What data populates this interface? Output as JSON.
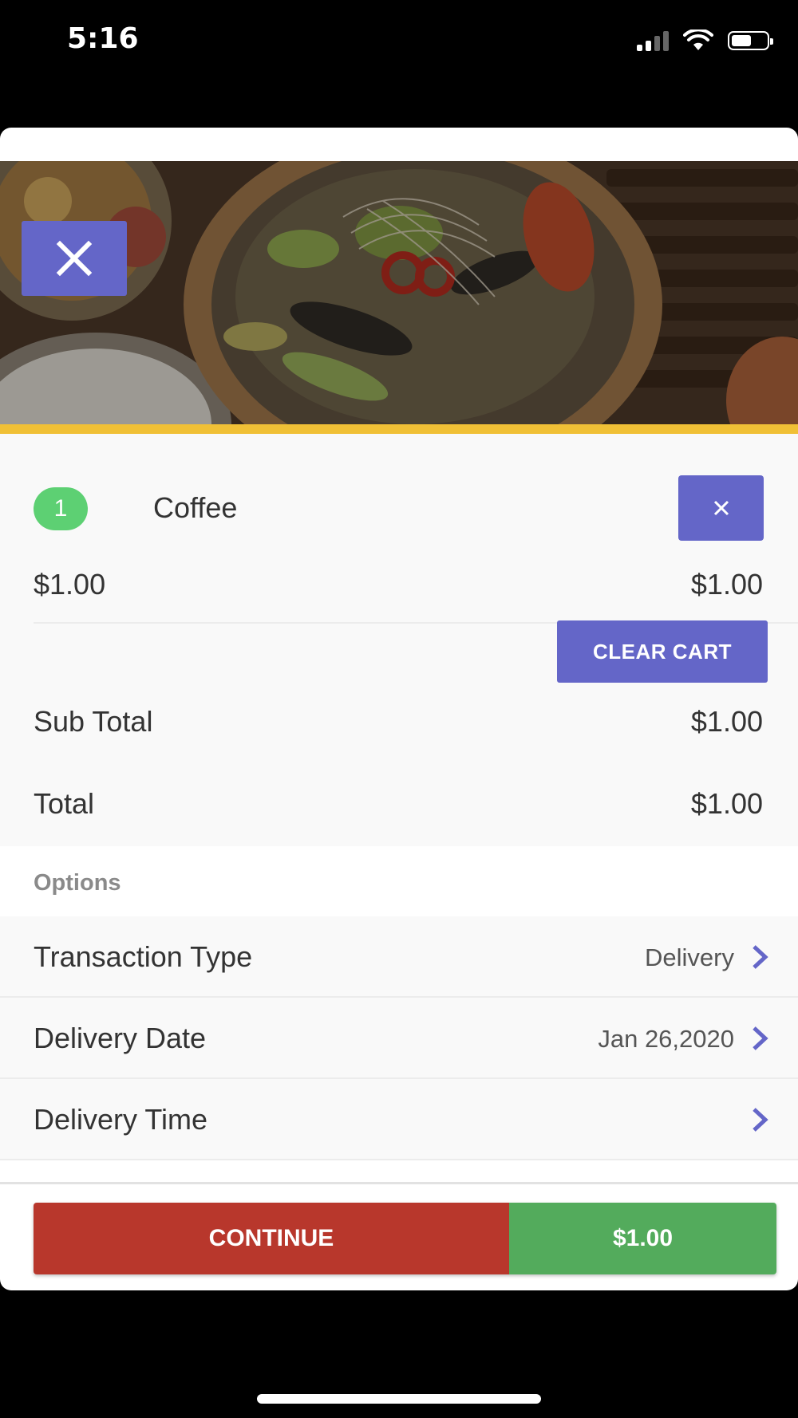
{
  "status_bar": {
    "time": "5:16"
  },
  "hero": {
    "close_icon": "close-icon"
  },
  "cart": {
    "items": [
      {
        "quantity": "1",
        "name": "Coffee",
        "unit_price": "$1.00",
        "line_total": "$1.00",
        "remove_icon": "close-icon"
      }
    ],
    "clear_cart_label": "CLEAR CART",
    "subtotal_label": "Sub Total",
    "subtotal_value": "$1.00",
    "total_label": "Total",
    "total_value": "$1.00"
  },
  "options": {
    "header": "Options",
    "rows": [
      {
        "label": "Transaction Type",
        "value": "Delivery"
      },
      {
        "label": "Delivery Date",
        "value": "Jan 26,2020"
      },
      {
        "label": "Delivery Time",
        "value": ""
      }
    ]
  },
  "footer": {
    "continue_label": "CONTINUE",
    "total": "$1.00"
  },
  "colors": {
    "accent": "#6466c8",
    "badge_green": "#5dd073",
    "continue_red": "#b8372c",
    "total_green": "#53ab5c",
    "hero_border": "#f0c036"
  }
}
